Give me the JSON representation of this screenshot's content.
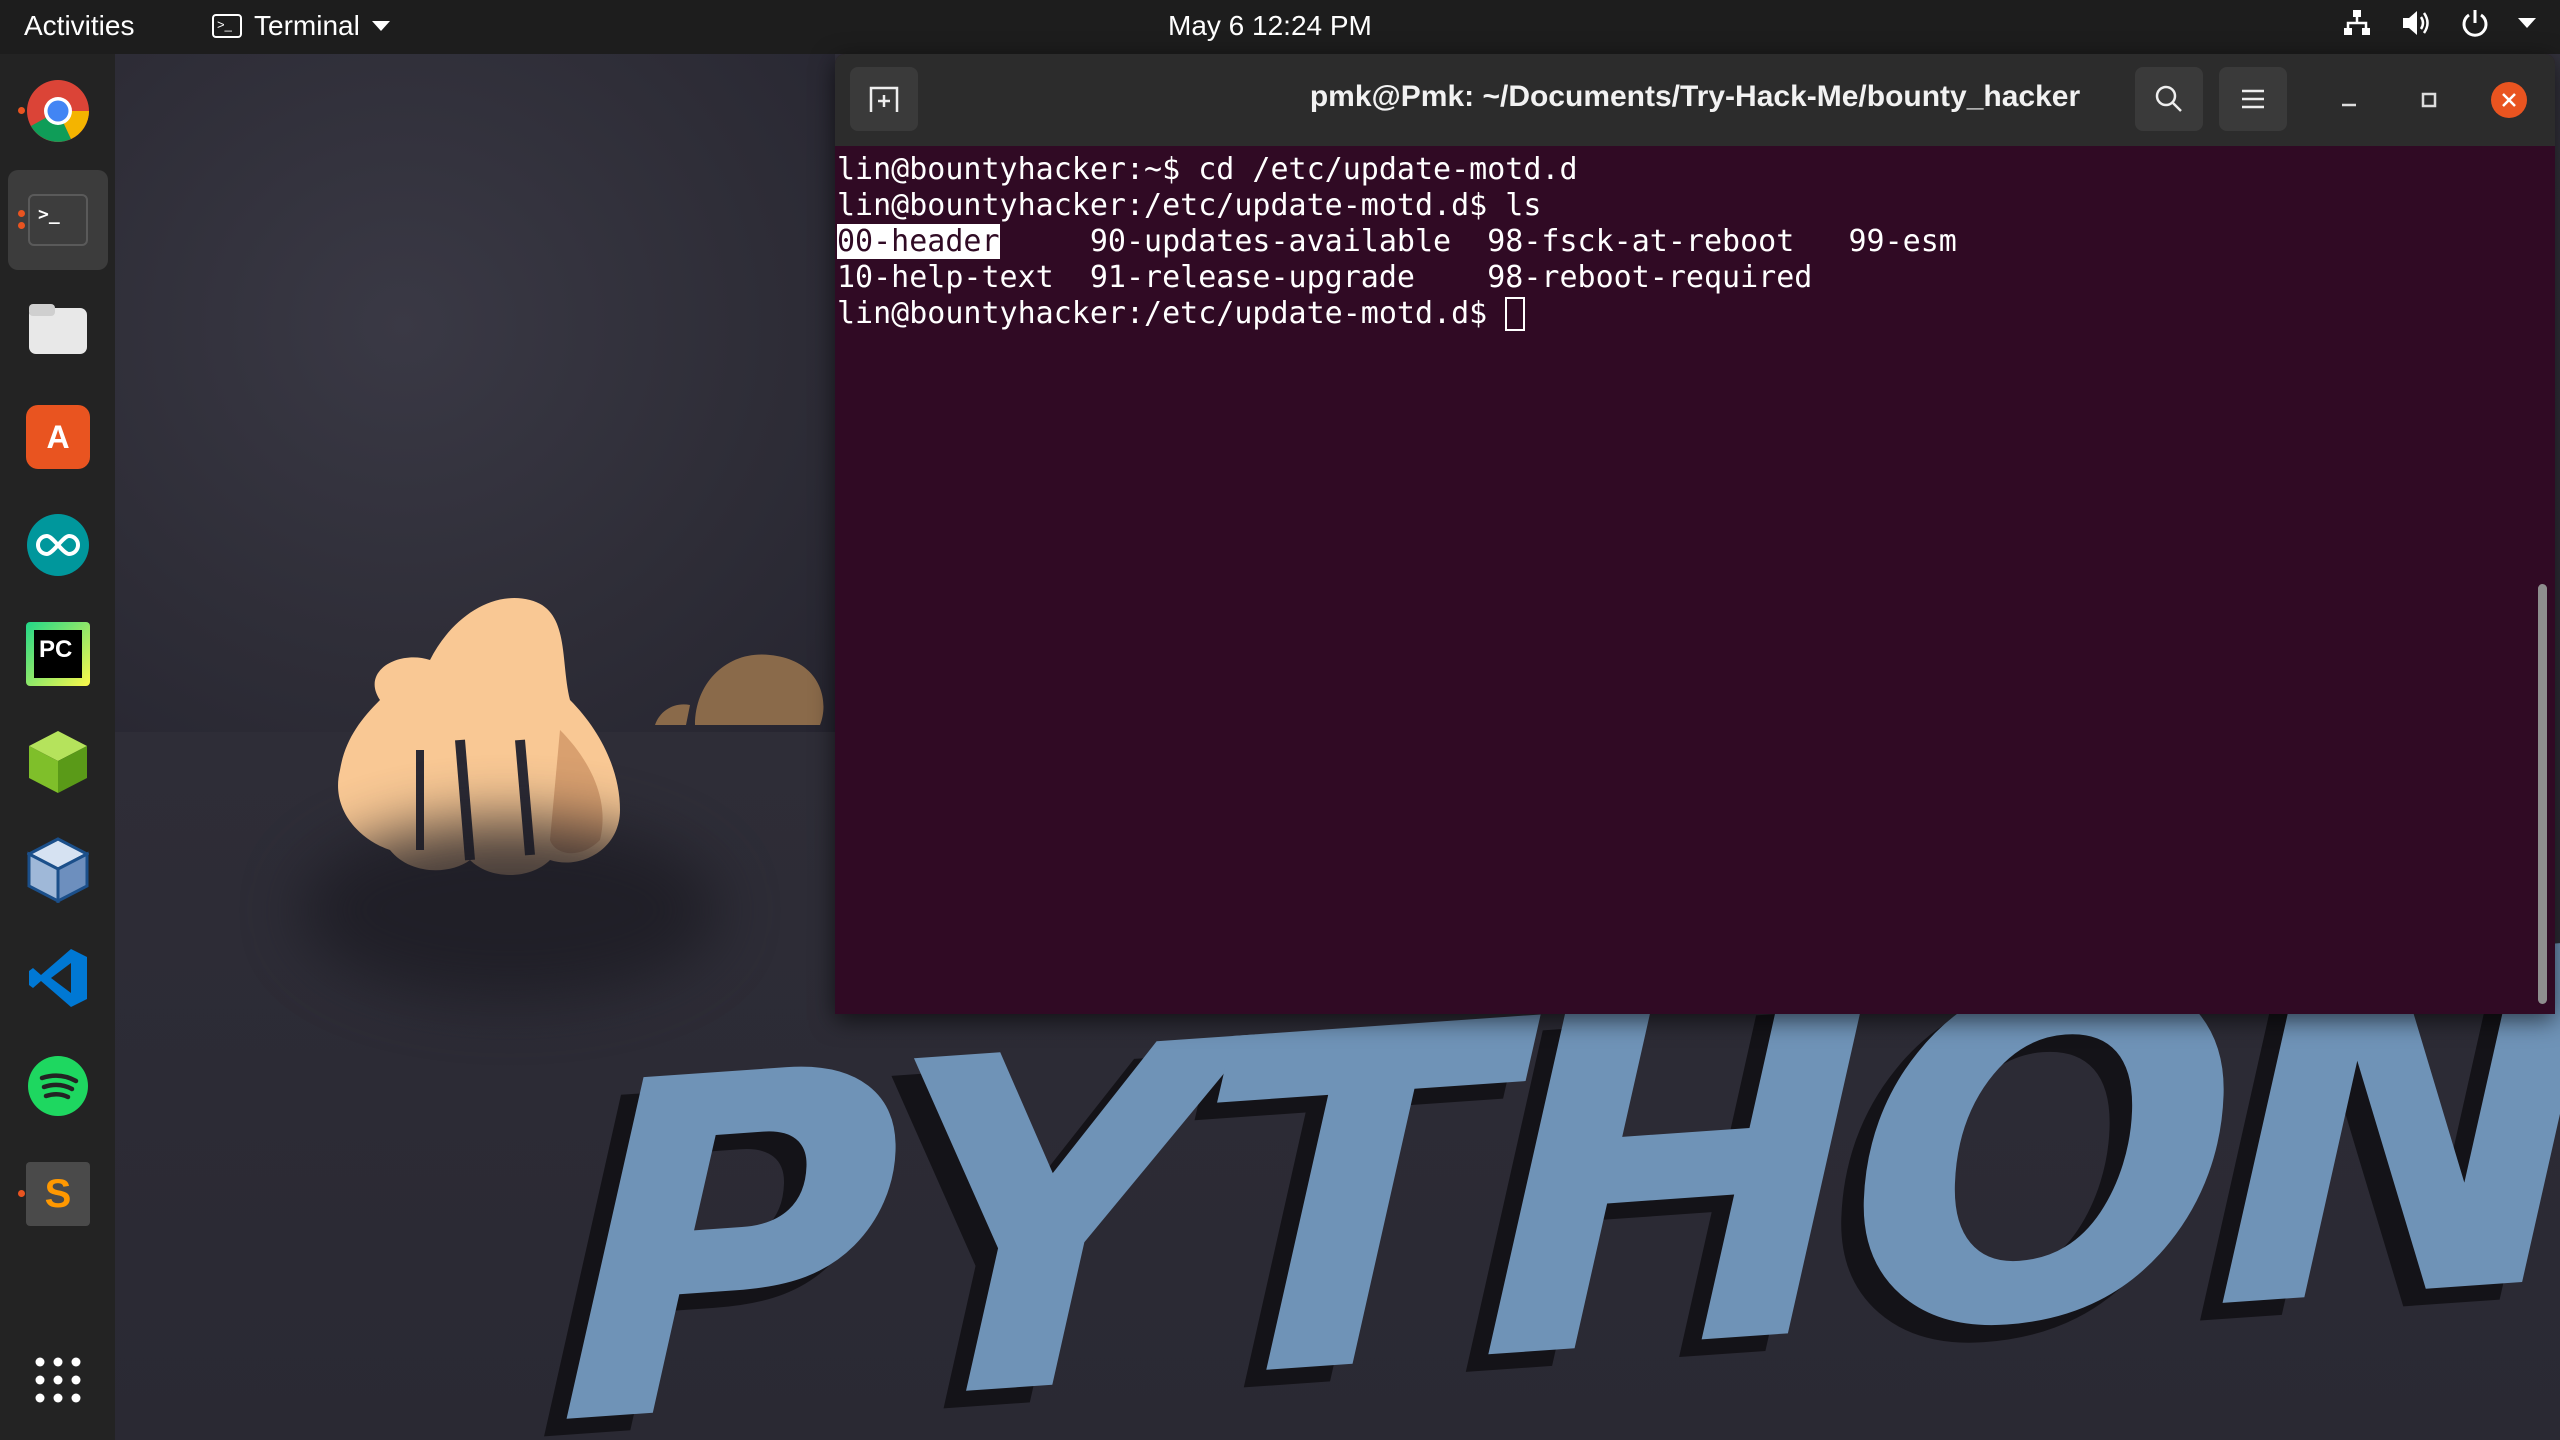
{
  "topbar": {
    "activities": "Activities",
    "app_name": "Terminal",
    "clock": "May 6  12:24 PM"
  },
  "dock": {
    "apps": [
      "google-chrome",
      "terminal",
      "files",
      "ubuntu-software",
      "arduino",
      "pycharm",
      "3d-app",
      "virtualbox",
      "vscode",
      "spotify",
      "sublime-text",
      "show-applications"
    ]
  },
  "terminal": {
    "title": "pmk@Pmk: ~/Documents/Try-Hack-Me/bounty_hacker",
    "lines": [
      "lin@bountyhacker:~$ cd /etc/update-motd.d",
      "lin@bountyhacker:/etc/update-motd.d$ ls"
    ],
    "ls_row1": {
      "selected": "00-header",
      "rest": "     90-updates-available  98-fsck-at-reboot   99-esm"
    },
    "ls_row2": "10-help-text  91-release-upgrade    98-reboot-required",
    "prompt": "lin@bountyhacker:/etc/update-motd.d$ "
  },
  "colors": {
    "terminal_bg": "#300a24",
    "accent": "#e95420",
    "wallpaper_text": "#6f93b7"
  },
  "wallpaper": {
    "text": "PYTHON"
  }
}
